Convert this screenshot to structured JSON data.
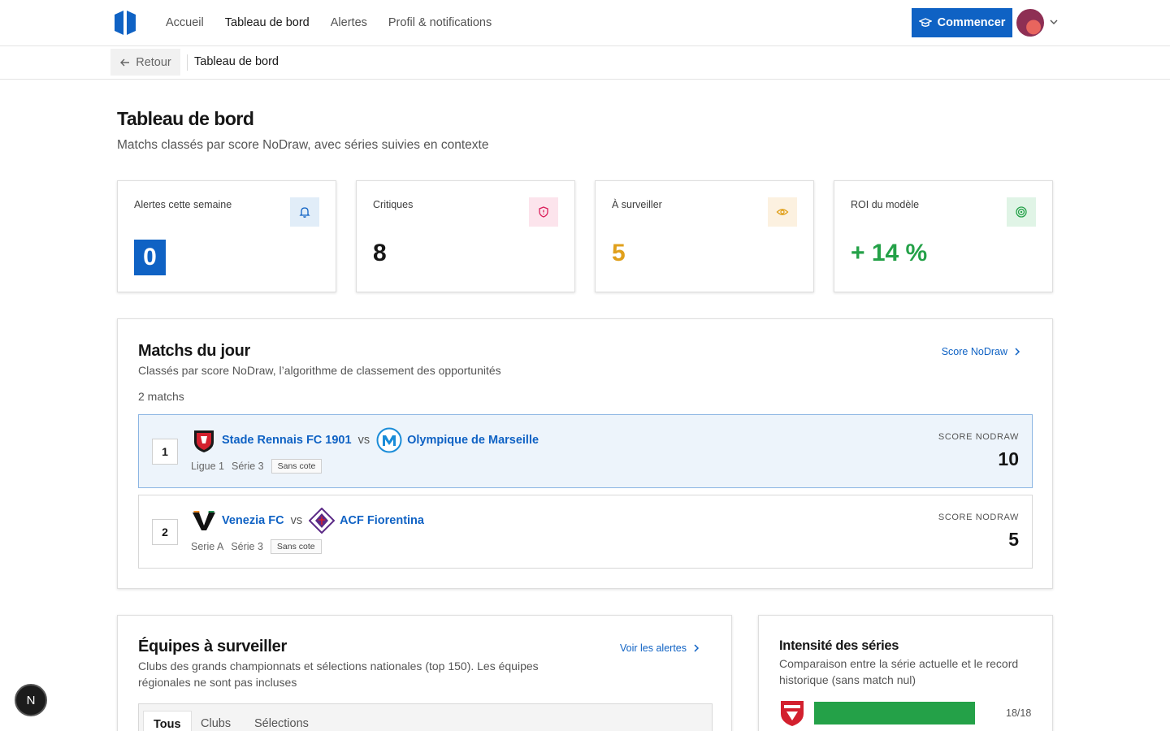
{
  "nav": {
    "links": [
      "Accueil",
      "Tableau de bord",
      "Alertes",
      "Profil & notifications"
    ],
    "active": "Tableau de bord",
    "cta_label": "Commencer"
  },
  "breadcrumb": {
    "back_label": "Retour",
    "current": "Tableau de bord"
  },
  "page": {
    "title": "Tableau de bord",
    "subtitle": "Matchs classés par score NoDraw, avec séries suivies en contexte"
  },
  "stats": [
    {
      "label": "Alertes cette semaine",
      "value": "0",
      "icon": "bell-icon",
      "color": "#0f62c4"
    },
    {
      "label": "Critiques",
      "value": "8",
      "icon": "shield-alert-icon",
      "color": "#da1e5a"
    },
    {
      "label": "À surveiller",
      "value": "5",
      "icon": "eye-icon",
      "color": "#e0a01c"
    },
    {
      "label": "ROI du modèle",
      "value": "+ 14 %",
      "icon": "target-icon",
      "color": "#24a148"
    }
  ],
  "matches": {
    "title": "Matchs du jour",
    "subtitle": "Classés par score NoDraw, l’algorithme de classement des opportunités",
    "link_label": "Score NoDraw",
    "count_label": "2 matchs",
    "score_label": "SCORE NODRAW",
    "rows": [
      {
        "rank": "1",
        "home": "Stade Rennais FC 1901",
        "vs": "vs",
        "away": "Olympique de Marseille",
        "league": "Ligue 1",
        "series": "Série 3",
        "tag": "Sans cote",
        "score": "10"
      },
      {
        "rank": "2",
        "home": "Venezia FC",
        "vs": "vs",
        "away": "ACF Fiorentina",
        "league": "Serie A",
        "series": "Série 3",
        "tag": "Sans cote",
        "score": "5"
      }
    ]
  },
  "watch": {
    "title": "Équipes à surveiller",
    "subtitle": "Clubs des grands championnats et sélections nationales (top 150). Les équipes régionales ne sont pas incluses",
    "link_label": "Voir les alertes",
    "tabs": [
      "Tous",
      "Clubs",
      "Sélections"
    ]
  },
  "intensity": {
    "title": "Intensité des séries",
    "subtitle": "Comparaison entre la série actuelle et le record historique (sans match nul)",
    "bar_label": "18/18",
    "bar_progress": 1.0
  },
  "float_button": "N"
}
